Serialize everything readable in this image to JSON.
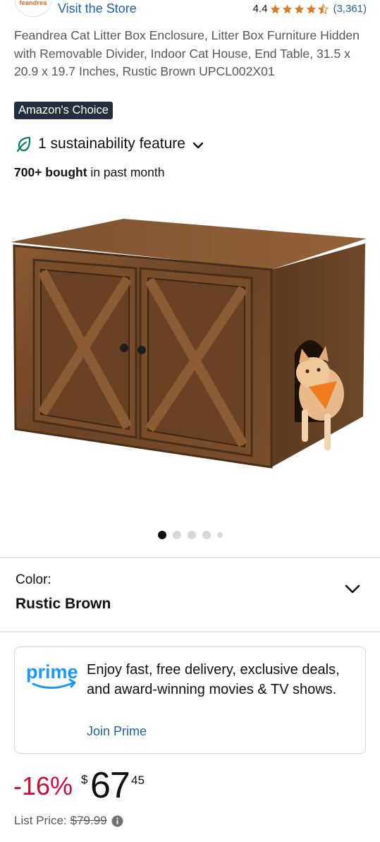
{
  "header": {
    "store_logo_text": "feandrea",
    "visit_store": "Visit the Store",
    "rating": "4.4",
    "rating_count": "(3,361)",
    "stars": [
      "full",
      "full",
      "full",
      "full",
      "half"
    ]
  },
  "product": {
    "title": "Feandrea Cat Litter Box Enclosure, Litter Box Furniture Hidden with Removable Divider, Indoor Cat House, End Table, 31.5 x 20.9 x 19.7 Inches, Rustic Brown UPCL002X01",
    "badge": "Amazon's Choice",
    "sustainability": "1 sustainability feature",
    "bought_bold": "700+ bought",
    "bought_rest": " in past month"
  },
  "carousel": {
    "total": 5,
    "active": 1
  },
  "color": {
    "label": "Color:",
    "value": "Rustic Brown"
  },
  "prime": {
    "logo_text": "prime",
    "text": "Enjoy fast, free delivery, exclusive deals, and award-winning movies & TV shows.",
    "join": "Join Prime"
  },
  "price": {
    "discount": "-16%",
    "symbol": "$",
    "whole": "67",
    "fraction": "45",
    "list_label": "List Price:",
    "list_value": "$79.99"
  },
  "colors": {
    "link": "#2162a1",
    "star": "#de7921",
    "discount": "#cc0c39",
    "badge_bg": "#232f3e",
    "prime": "#1a98ff",
    "sustain": "#067d62"
  }
}
